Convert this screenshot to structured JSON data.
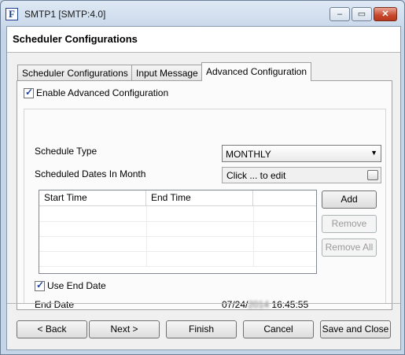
{
  "window": {
    "title": "SMTP1 [SMTP:4.0]",
    "icon_letter": "F",
    "controls": {
      "minimize": "‒",
      "maximize": "▭",
      "close": "✕"
    }
  },
  "header": {
    "title": "Scheduler Configurations"
  },
  "tabs": [
    {
      "label": "Scheduler Configurations"
    },
    {
      "label": "Input Message"
    },
    {
      "label": "Advanced Configuration"
    }
  ],
  "advanced": {
    "enable_label": "Enable Advanced Configuration",
    "enable_checked": true,
    "schedule_type_label": "Schedule Type",
    "schedule_type_value": "MONTHLY",
    "dates_label": "Scheduled Dates In Month",
    "dates_value": "Click ... to edit",
    "table": {
      "columns": [
        "Start Time",
        "End Time",
        ""
      ],
      "rows": []
    },
    "buttons": {
      "add": "Add",
      "remove": "Remove",
      "remove_all": "Remove All"
    },
    "use_end_date_label": "Use End Date",
    "use_end_date_checked": true,
    "end_date_label": "End Date",
    "end_date_prefix": "07/24/",
    "end_date_year_obscured": "2014",
    "end_date_time": " 16:45:55"
  },
  "footer": {
    "back": "< Back",
    "next": "Next >",
    "finish": "Finish",
    "cancel": "Cancel",
    "save_close": "Save and Close"
  },
  "colors": {
    "accent": "#22439b",
    "close_button": "#c7472d"
  }
}
